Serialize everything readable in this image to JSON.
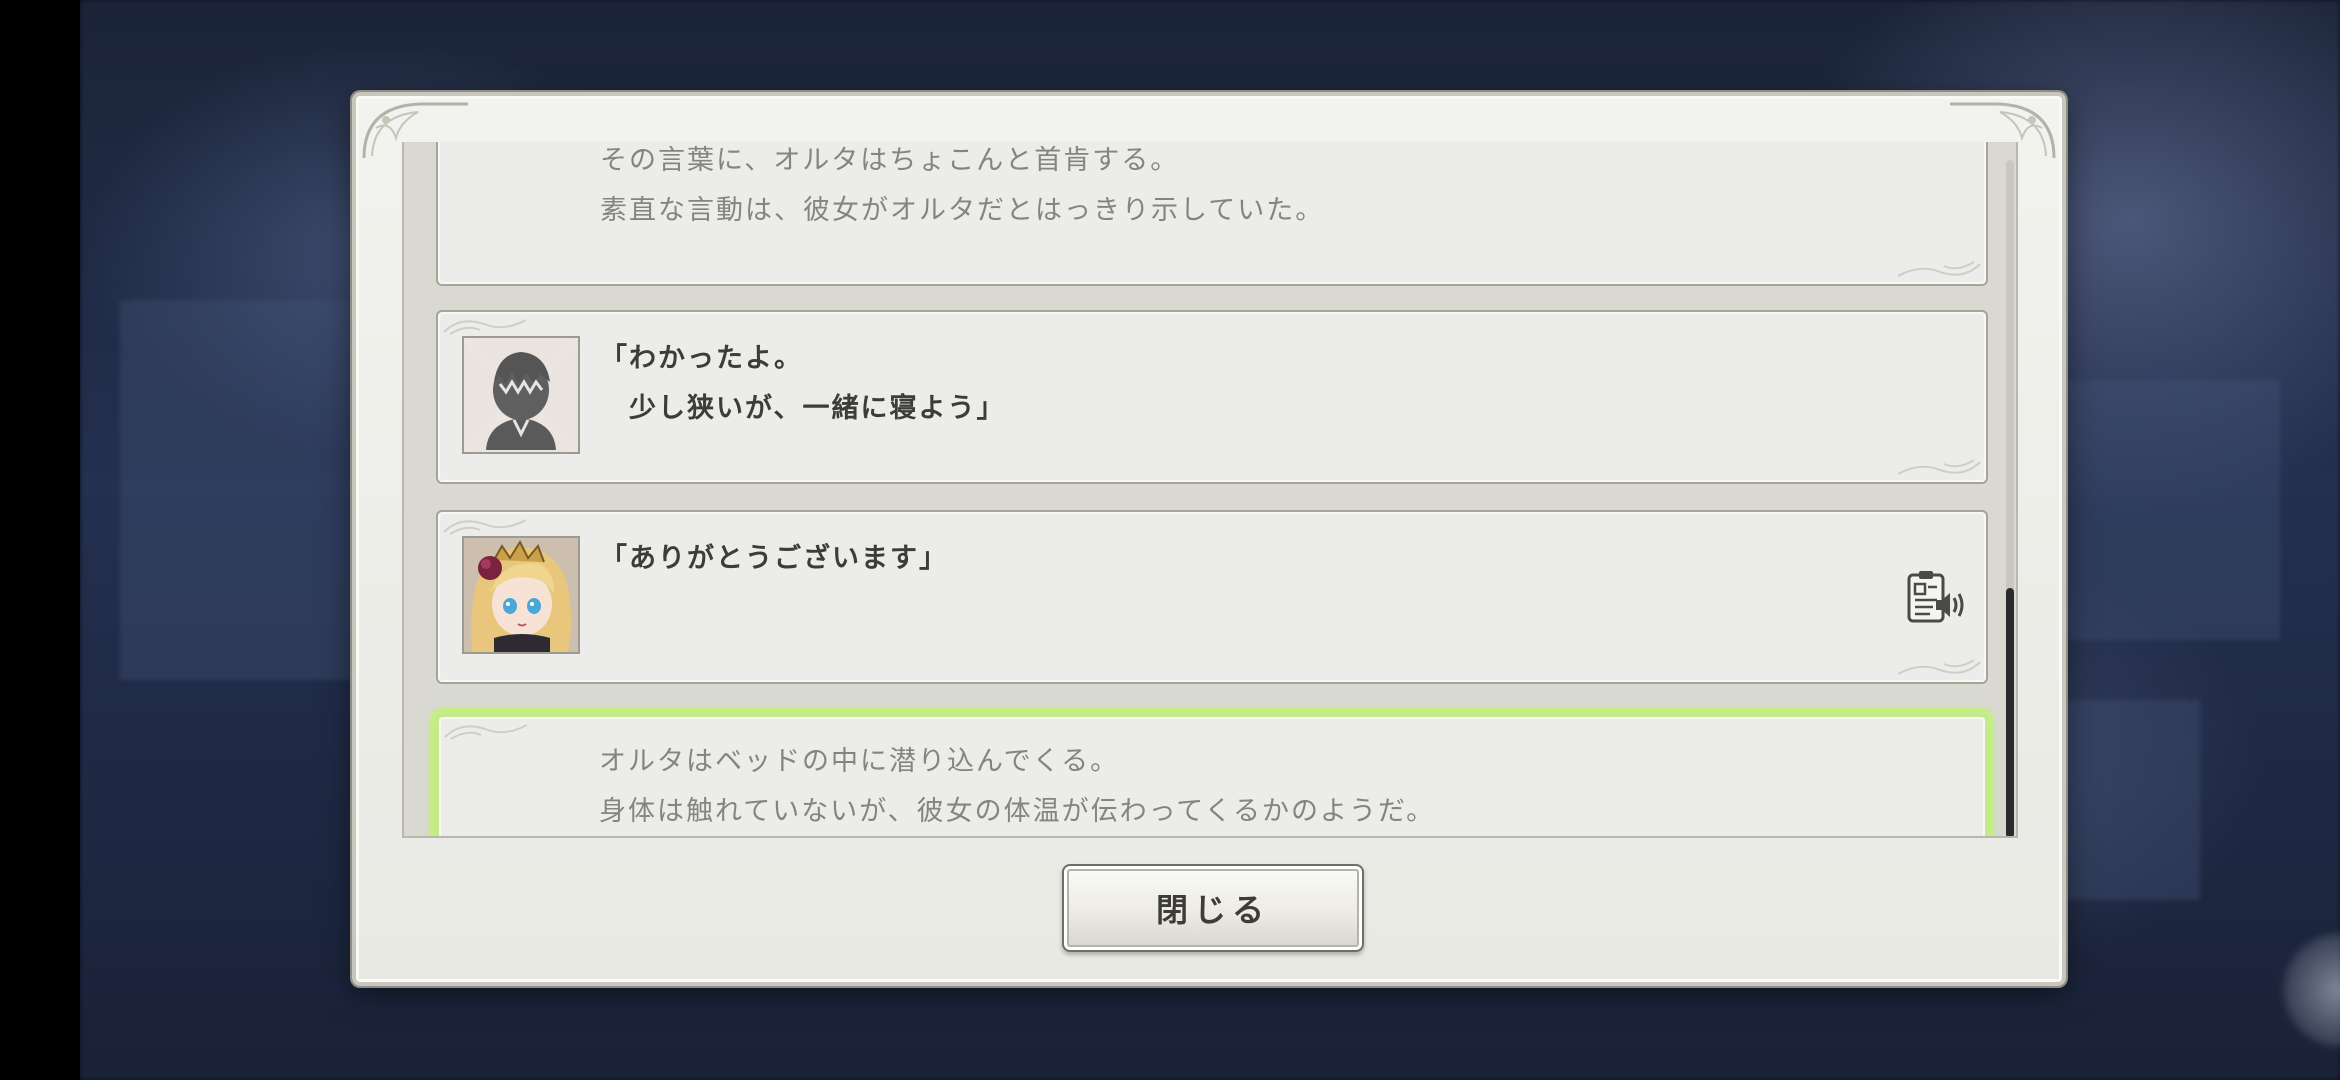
{
  "log": {
    "entries": [
      {
        "type": "narration",
        "lines": [
          "その言葉に、オルタはちょこんと首肯する。",
          "素直な言動は、彼女がオルタだとはっきり示していた。"
        ]
      },
      {
        "type": "dialogue",
        "speaker_portrait": "protagonist-silhouette",
        "lines": [
          "「わかったよ。",
          "　少し狭いが、一緒に寝よう」"
        ]
      },
      {
        "type": "dialogue",
        "speaker_portrait": "alter-blonde-girl",
        "lines": [
          "「ありがとうございます」"
        ],
        "voice_icon": "voice-replay-icon"
      },
      {
        "type": "narration",
        "highlighted": true,
        "lines": [
          "オルタはベッドの中に潜り込んでくる。",
          "身体は触れていないが、彼女の体温が伝わってくるかのようだ。"
        ]
      }
    ],
    "scroll_position": 1.0
  },
  "buttons": {
    "close_label": "閉じる"
  },
  "colors": {
    "panel": "#ececea",
    "frame": "#a6a59c",
    "highlight": "#c4e88a",
    "narration_text": "#858580",
    "dialogue_text": "#3c3c3a"
  }
}
